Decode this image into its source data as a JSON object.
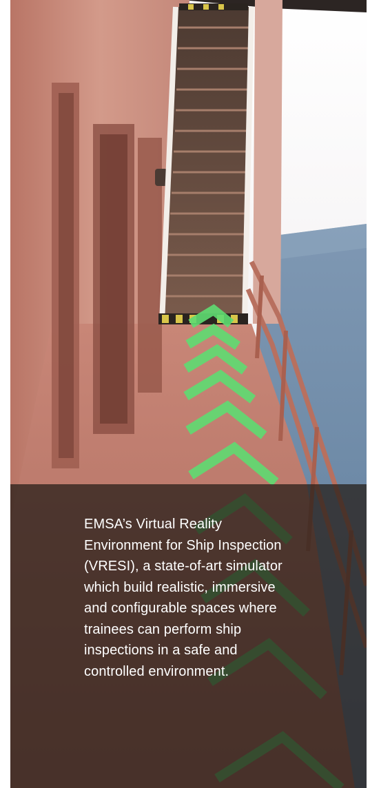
{
  "photo": {
    "subject": "photo-ship-deck-vr-simulation",
    "colors": {
      "hull": "#c98a7c",
      "deck": "#c27d6e",
      "stairs": "#6b5144",
      "sky": "#e8e4e6",
      "sea": "#5f7f9e",
      "arrow": "#58d66a"
    }
  },
  "caption": {
    "text": "EMSA’s Virtual Reality Environment for Ship Inspection (VRESI), a state-of-art simulator which build realistic, immersive and configurable spaces where trainees can perform ship inspections in a safe and controlled environment."
  }
}
